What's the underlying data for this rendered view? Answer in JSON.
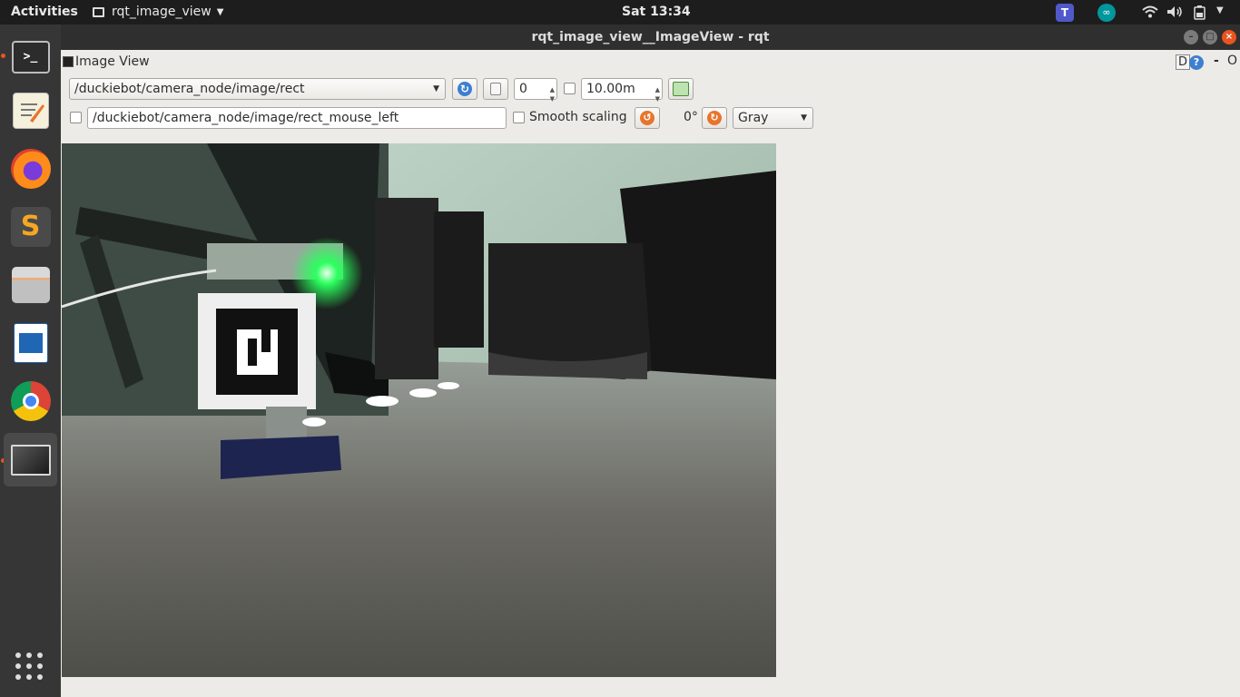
{
  "topbar": {
    "activities": "Activities",
    "app_menu": "rqt_image_view",
    "clock": "Sat 13:34"
  },
  "tray_icons": [
    "teams-icon",
    "arduino-icon",
    "wifi-icon",
    "volume-icon",
    "battery-icon"
  ],
  "dock": {
    "items": [
      "terminal",
      "text-editor",
      "firefox",
      "sublime-text",
      "files",
      "libreoffice-writer",
      "chrome",
      "rqt-window"
    ],
    "running": [
      "terminal",
      "rqt-window"
    ],
    "active": "rqt-window"
  },
  "window": {
    "title": "rqt_image_view__ImageView - rqt"
  },
  "plugin": {
    "title": "Image View",
    "help_d": "D",
    "help_q": "?",
    "minus": "-",
    "close": "O"
  },
  "toolbar": {
    "topic": "/duckiebot/camera_node/image/rect",
    "spin_value": "0",
    "max_range": "10.00m",
    "mouse_topic": "/duckiebot/camera_node/image/rect_mouse_left",
    "smooth_scaling_label": "Smooth scaling",
    "rotation": "0°",
    "color_scheme": "Gray",
    "max_range_checked": false,
    "mouse_topic_checked": false,
    "smooth_scaling_checked": false
  },
  "colors": {
    "accent": "#e95420",
    "topbar": "#1d1d1d",
    "dock": "#363636",
    "window_bg": "#edebe7",
    "led": "#2bff5e"
  }
}
